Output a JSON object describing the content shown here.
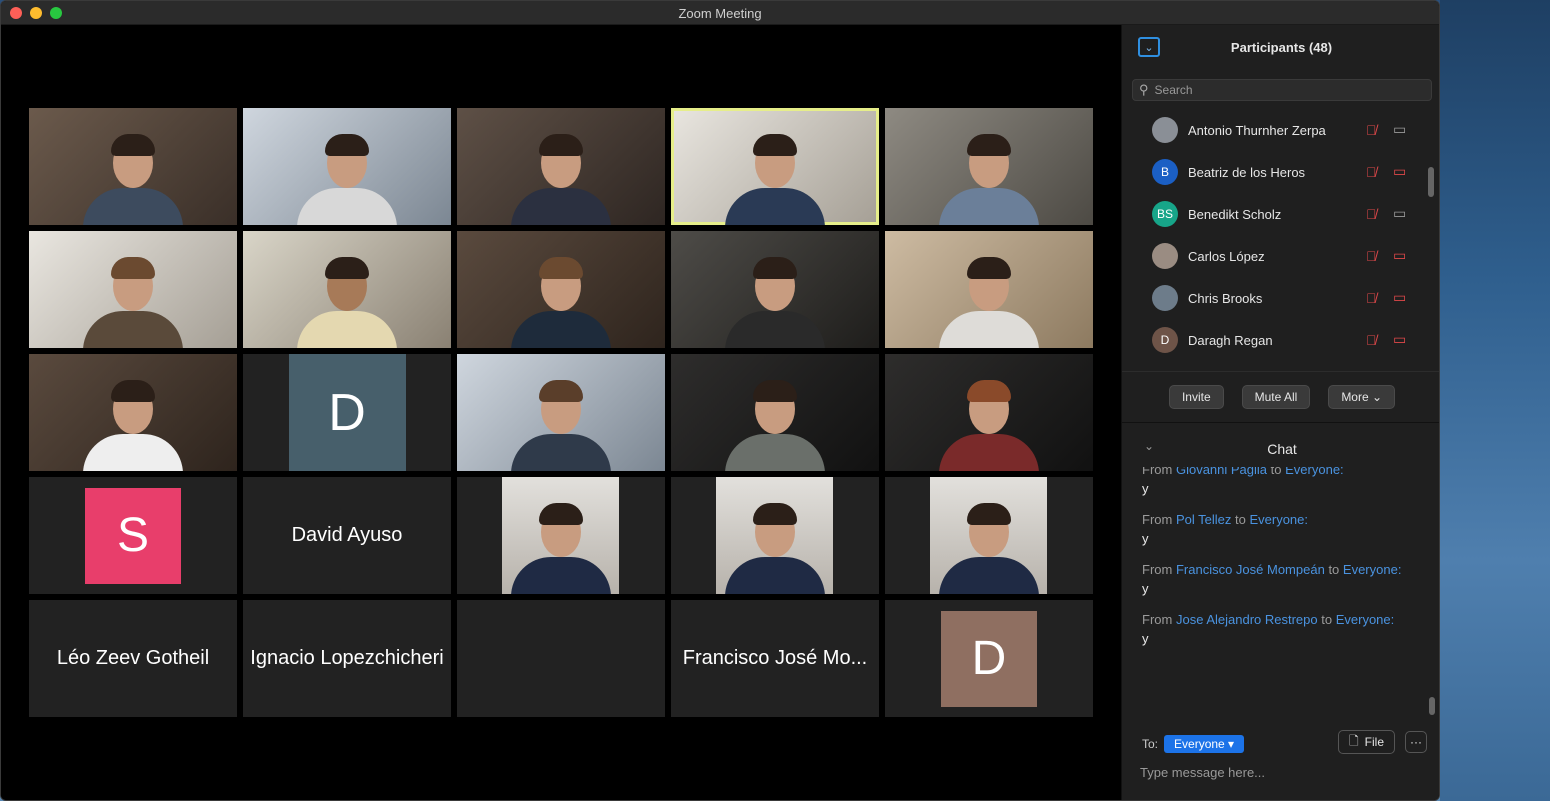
{
  "window": {
    "title": "Zoom Meeting"
  },
  "grid": {
    "tiles": [
      {
        "type": "video"
      },
      {
        "type": "video"
      },
      {
        "type": "video"
      },
      {
        "type": "video",
        "active": true
      },
      {
        "type": "video"
      },
      {
        "type": "video"
      },
      {
        "type": "video"
      },
      {
        "type": "video"
      },
      {
        "type": "video"
      },
      {
        "type": "video"
      },
      {
        "type": "video"
      },
      {
        "type": "avatar",
        "initial": "D",
        "color": "#475f6b"
      },
      {
        "type": "video"
      },
      {
        "type": "video"
      },
      {
        "type": "video"
      },
      {
        "type": "avatar",
        "initial": "S",
        "color": "#e83e6b"
      },
      {
        "type": "name",
        "name": "David Ayuso"
      },
      {
        "type": "photo"
      },
      {
        "type": "photo"
      },
      {
        "type": "photo"
      },
      {
        "type": "name",
        "name": "Léo Zeev Gotheil"
      },
      {
        "type": "name",
        "name": "Ignacio Lopezchicheri"
      },
      {
        "type": "empty"
      },
      {
        "type": "name",
        "name": "Francisco José Mo..."
      },
      {
        "type": "avatar",
        "initial": "D",
        "color": "#8f6f61"
      }
    ]
  },
  "participants": {
    "title": "Participants (48)",
    "search_placeholder": "Search",
    "list": [
      {
        "name": "Antonio Thurnher Zerpa",
        "initials": "",
        "avatar_color": "#8a8f96",
        "mic": "muted",
        "camera": "on"
      },
      {
        "name": "Beatriz de los Heros",
        "initials": "B",
        "avatar_color": "#1b5fc4",
        "mic": "muted",
        "camera": "off"
      },
      {
        "name": "Benedikt Scholz",
        "initials": "BS",
        "avatar_color": "#17a589",
        "mic": "muted",
        "camera": "on"
      },
      {
        "name": "Carlos López",
        "initials": "",
        "avatar_color": "#9a8c82",
        "mic": "muted",
        "camera": "off"
      },
      {
        "name": "Chris Brooks",
        "initials": "",
        "avatar_color": "#6d7c8a",
        "mic": "muted",
        "camera": "off"
      },
      {
        "name": "Daragh Regan",
        "initials": "D",
        "avatar_color": "#6e5448",
        "mic": "muted",
        "camera": "off"
      }
    ],
    "buttons": {
      "invite": "Invite",
      "mute_all": "Mute All",
      "more": "More ⌄"
    }
  },
  "chat": {
    "title": "Chat",
    "messages": [
      {
        "from_prefix": "From",
        "from": "Giovanni Paglia",
        "to_prefix": "to",
        "to": "Everyone:",
        "text": "y"
      },
      {
        "from_prefix": "From",
        "from": "Pol Tellez",
        "to_prefix": "to",
        "to": "Everyone:",
        "text": "y"
      },
      {
        "from_prefix": "From",
        "from": "Francisco José Mompeán",
        "to_prefix": "to",
        "to": "Everyone:",
        "text": "y"
      },
      {
        "from_prefix": "From",
        "from": "Jose Alejandro Restrepo",
        "to_prefix": "to",
        "to": "Everyone:",
        "text": "y"
      }
    ],
    "to_label": "To:",
    "to_value": "Everyone ▾",
    "file_label": "File",
    "more_label": "···",
    "input_placeholder": "Type message here..."
  }
}
